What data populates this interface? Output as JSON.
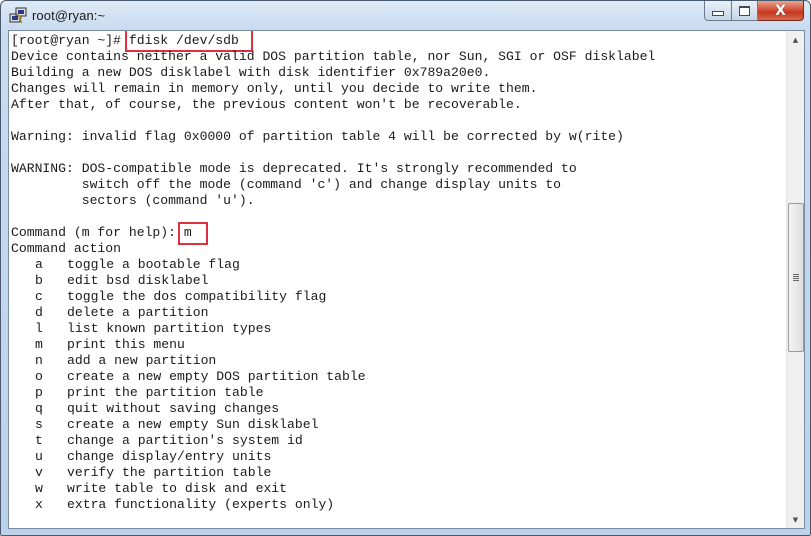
{
  "window": {
    "title": "root@ryan:~",
    "app_icon": "putty-icon",
    "controls": {
      "minimize": "minimize",
      "maximize": "maximize",
      "close": "X"
    }
  },
  "terminal": {
    "prompt": "[root@ryan ~]# ",
    "command": "fdisk /dev/sdb",
    "output": [
      "Device contains neither a valid DOS partition table, nor Sun, SGI or OSF disklabel",
      "Building a new DOS disklabel with disk identifier 0x789a20e0.",
      "Changes will remain in memory only, until you decide to write them.",
      "After that, of course, the previous content won't be recoverable.",
      "",
      "Warning: invalid flag 0x0000 of partition table 4 will be corrected by w(rite)",
      "",
      "WARNING: DOS-compatible mode is deprecated. It's strongly recommended to",
      "         switch off the mode (command 'c') and change display units to",
      "         sectors (command 'u').",
      ""
    ],
    "command_prompt": "Command (m for help): ",
    "command_input": "m",
    "menu_header": "Command action",
    "menu": [
      {
        "key": "a",
        "desc": "toggle a bootable flag"
      },
      {
        "key": "b",
        "desc": "edit bsd disklabel"
      },
      {
        "key": "c",
        "desc": "toggle the dos compatibility flag"
      },
      {
        "key": "d",
        "desc": "delete a partition"
      },
      {
        "key": "l",
        "desc": "list known partition types"
      },
      {
        "key": "m",
        "desc": "print this menu"
      },
      {
        "key": "n",
        "desc": "add a new partition"
      },
      {
        "key": "o",
        "desc": "create a new empty DOS partition table"
      },
      {
        "key": "p",
        "desc": "print the partition table"
      },
      {
        "key": "q",
        "desc": "quit without saving changes"
      },
      {
        "key": "s",
        "desc": "create a new empty Sun disklabel"
      },
      {
        "key": "t",
        "desc": "change a partition's system id"
      },
      {
        "key": "u",
        "desc": "change display/entry units"
      },
      {
        "key": "v",
        "desc": "verify the partition table"
      },
      {
        "key": "w",
        "desc": "write table to disk and exit"
      },
      {
        "key": "x",
        "desc": "extra functionality (experts only)"
      }
    ],
    "highlight_color": "#e03040"
  },
  "scrollbar": {
    "up_arrow": "▲",
    "down_arrow": "▼"
  }
}
